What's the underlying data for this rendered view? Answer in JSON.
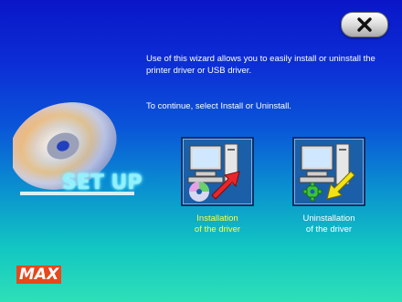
{
  "wizard": {
    "intro_text": "Use of this wizard allows you to easily install or uninstall the printer driver or USB driver.",
    "instruction_text": "To continue, select Install or Uninstall."
  },
  "close_button": {
    "icon": "close-icon"
  },
  "cd_graphic": {
    "label": "SET UP",
    "icon": "cd-disc-icon"
  },
  "options": {
    "install": {
      "label_line1": "Installation",
      "label_line2": "of the driver",
      "icon": "install-driver-icon",
      "label_color": "#ffff3a"
    },
    "uninstall": {
      "label_line1": "Uninstallation",
      "label_line2": "of the driver",
      "icon": "uninstall-driver-icon",
      "label_color": "#ffffff"
    }
  },
  "brand": {
    "logo_text": "MAX",
    "color": "#e8481a"
  }
}
